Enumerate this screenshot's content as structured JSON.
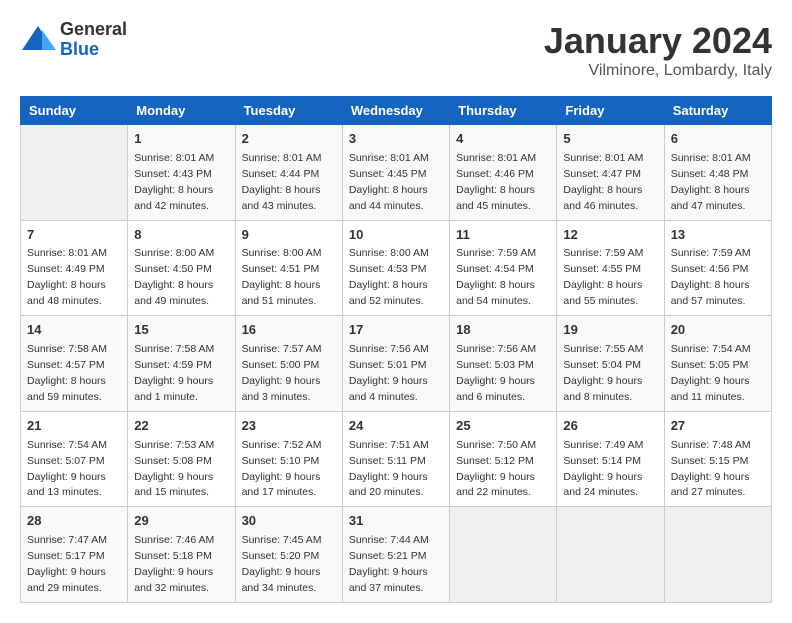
{
  "logo": {
    "general": "General",
    "blue": "Blue"
  },
  "title": "January 2024",
  "location": "Vilminore, Lombardy, Italy",
  "days_of_week": [
    "Sunday",
    "Monday",
    "Tuesday",
    "Wednesday",
    "Thursday",
    "Friday",
    "Saturday"
  ],
  "weeks": [
    [
      {
        "day": "",
        "sunrise": "",
        "sunset": "",
        "daylight": "",
        "empty": true
      },
      {
        "day": "1",
        "sunrise": "Sunrise: 8:01 AM",
        "sunset": "Sunset: 4:43 PM",
        "daylight": "Daylight: 8 hours and 42 minutes."
      },
      {
        "day": "2",
        "sunrise": "Sunrise: 8:01 AM",
        "sunset": "Sunset: 4:44 PM",
        "daylight": "Daylight: 8 hours and 43 minutes."
      },
      {
        "day": "3",
        "sunrise": "Sunrise: 8:01 AM",
        "sunset": "Sunset: 4:45 PM",
        "daylight": "Daylight: 8 hours and 44 minutes."
      },
      {
        "day": "4",
        "sunrise": "Sunrise: 8:01 AM",
        "sunset": "Sunset: 4:46 PM",
        "daylight": "Daylight: 8 hours and 45 minutes."
      },
      {
        "day": "5",
        "sunrise": "Sunrise: 8:01 AM",
        "sunset": "Sunset: 4:47 PM",
        "daylight": "Daylight: 8 hours and 46 minutes."
      },
      {
        "day": "6",
        "sunrise": "Sunrise: 8:01 AM",
        "sunset": "Sunset: 4:48 PM",
        "daylight": "Daylight: 8 hours and 47 minutes."
      }
    ],
    [
      {
        "day": "7",
        "sunrise": "Sunrise: 8:01 AM",
        "sunset": "Sunset: 4:49 PM",
        "daylight": "Daylight: 8 hours and 48 minutes."
      },
      {
        "day": "8",
        "sunrise": "Sunrise: 8:00 AM",
        "sunset": "Sunset: 4:50 PM",
        "daylight": "Daylight: 8 hours and 49 minutes."
      },
      {
        "day": "9",
        "sunrise": "Sunrise: 8:00 AM",
        "sunset": "Sunset: 4:51 PM",
        "daylight": "Daylight: 8 hours and 51 minutes."
      },
      {
        "day": "10",
        "sunrise": "Sunrise: 8:00 AM",
        "sunset": "Sunset: 4:53 PM",
        "daylight": "Daylight: 8 hours and 52 minutes."
      },
      {
        "day": "11",
        "sunrise": "Sunrise: 7:59 AM",
        "sunset": "Sunset: 4:54 PM",
        "daylight": "Daylight: 8 hours and 54 minutes."
      },
      {
        "day": "12",
        "sunrise": "Sunrise: 7:59 AM",
        "sunset": "Sunset: 4:55 PM",
        "daylight": "Daylight: 8 hours and 55 minutes."
      },
      {
        "day": "13",
        "sunrise": "Sunrise: 7:59 AM",
        "sunset": "Sunset: 4:56 PM",
        "daylight": "Daylight: 8 hours and 57 minutes."
      }
    ],
    [
      {
        "day": "14",
        "sunrise": "Sunrise: 7:58 AM",
        "sunset": "Sunset: 4:57 PM",
        "daylight": "Daylight: 8 hours and 59 minutes."
      },
      {
        "day": "15",
        "sunrise": "Sunrise: 7:58 AM",
        "sunset": "Sunset: 4:59 PM",
        "daylight": "Daylight: 9 hours and 1 minute."
      },
      {
        "day": "16",
        "sunrise": "Sunrise: 7:57 AM",
        "sunset": "Sunset: 5:00 PM",
        "daylight": "Daylight: 9 hours and 3 minutes."
      },
      {
        "day": "17",
        "sunrise": "Sunrise: 7:56 AM",
        "sunset": "Sunset: 5:01 PM",
        "daylight": "Daylight: 9 hours and 4 minutes."
      },
      {
        "day": "18",
        "sunrise": "Sunrise: 7:56 AM",
        "sunset": "Sunset: 5:03 PM",
        "daylight": "Daylight: 9 hours and 6 minutes."
      },
      {
        "day": "19",
        "sunrise": "Sunrise: 7:55 AM",
        "sunset": "Sunset: 5:04 PM",
        "daylight": "Daylight: 9 hours and 8 minutes."
      },
      {
        "day": "20",
        "sunrise": "Sunrise: 7:54 AM",
        "sunset": "Sunset: 5:05 PM",
        "daylight": "Daylight: 9 hours and 11 minutes."
      }
    ],
    [
      {
        "day": "21",
        "sunrise": "Sunrise: 7:54 AM",
        "sunset": "Sunset: 5:07 PM",
        "daylight": "Daylight: 9 hours and 13 minutes."
      },
      {
        "day": "22",
        "sunrise": "Sunrise: 7:53 AM",
        "sunset": "Sunset: 5:08 PM",
        "daylight": "Daylight: 9 hours and 15 minutes."
      },
      {
        "day": "23",
        "sunrise": "Sunrise: 7:52 AM",
        "sunset": "Sunset: 5:10 PM",
        "daylight": "Daylight: 9 hours and 17 minutes."
      },
      {
        "day": "24",
        "sunrise": "Sunrise: 7:51 AM",
        "sunset": "Sunset: 5:11 PM",
        "daylight": "Daylight: 9 hours and 20 minutes."
      },
      {
        "day": "25",
        "sunrise": "Sunrise: 7:50 AM",
        "sunset": "Sunset: 5:12 PM",
        "daylight": "Daylight: 9 hours and 22 minutes."
      },
      {
        "day": "26",
        "sunrise": "Sunrise: 7:49 AM",
        "sunset": "Sunset: 5:14 PM",
        "daylight": "Daylight: 9 hours and 24 minutes."
      },
      {
        "day": "27",
        "sunrise": "Sunrise: 7:48 AM",
        "sunset": "Sunset: 5:15 PM",
        "daylight": "Daylight: 9 hours and 27 minutes."
      }
    ],
    [
      {
        "day": "28",
        "sunrise": "Sunrise: 7:47 AM",
        "sunset": "Sunset: 5:17 PM",
        "daylight": "Daylight: 9 hours and 29 minutes."
      },
      {
        "day": "29",
        "sunrise": "Sunrise: 7:46 AM",
        "sunset": "Sunset: 5:18 PM",
        "daylight": "Daylight: 9 hours and 32 minutes."
      },
      {
        "day": "30",
        "sunrise": "Sunrise: 7:45 AM",
        "sunset": "Sunset: 5:20 PM",
        "daylight": "Daylight: 9 hours and 34 minutes."
      },
      {
        "day": "31",
        "sunrise": "Sunrise: 7:44 AM",
        "sunset": "Sunset: 5:21 PM",
        "daylight": "Daylight: 9 hours and 37 minutes."
      },
      {
        "day": "",
        "sunrise": "",
        "sunset": "",
        "daylight": "",
        "empty": true
      },
      {
        "day": "",
        "sunrise": "",
        "sunset": "",
        "daylight": "",
        "empty": true
      },
      {
        "day": "",
        "sunrise": "",
        "sunset": "",
        "daylight": "",
        "empty": true
      }
    ]
  ]
}
